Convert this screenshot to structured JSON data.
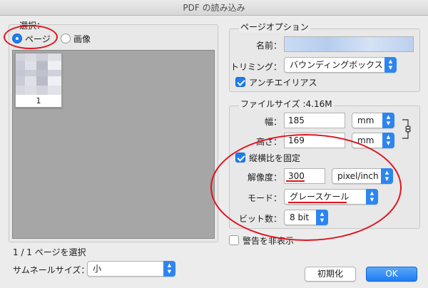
{
  "window": {
    "title": "PDF の読み込み"
  },
  "select": {
    "label": "選択：",
    "options": [
      {
        "label": "ページ",
        "selected": true
      },
      {
        "label": "画像",
        "selected": false
      }
    ]
  },
  "preview": {
    "thumb_page_number": "1"
  },
  "page_status": "1 / 1 ページを選択",
  "thumbnail_size": {
    "label": "サムネールサイズ：",
    "value": "小"
  },
  "page_options": {
    "label": "ページオプション",
    "name_label": "名前：",
    "trim_label": "トリミング：",
    "trim_value": "バウンディングボックス",
    "antialias_label": "アンチエイリアス",
    "antialias_checked": true
  },
  "image_size": {
    "label": "ファイルサイズ :4.16M",
    "width_label": "幅：",
    "width_value": "185",
    "width_unit": "mm",
    "height_label": "高さ：",
    "height_value": "169",
    "height_unit": "mm",
    "constrain_label": "縦横比を固定",
    "constrain_checked": true,
    "resolution_label": "解像度：",
    "resolution_value": "300",
    "resolution_unit": "pixel/inch",
    "mode_label": "モード：",
    "mode_value": "グレースケール",
    "bit_label": "ビット数：",
    "bit_value": "8 bit"
  },
  "suppress_warnings": {
    "label": "警告を非表示",
    "checked": false
  },
  "buttons": {
    "reset": "初期化",
    "ok": "OK"
  },
  "colors": {
    "accent": "#1d7ef0",
    "annotation": "#e0141e"
  }
}
